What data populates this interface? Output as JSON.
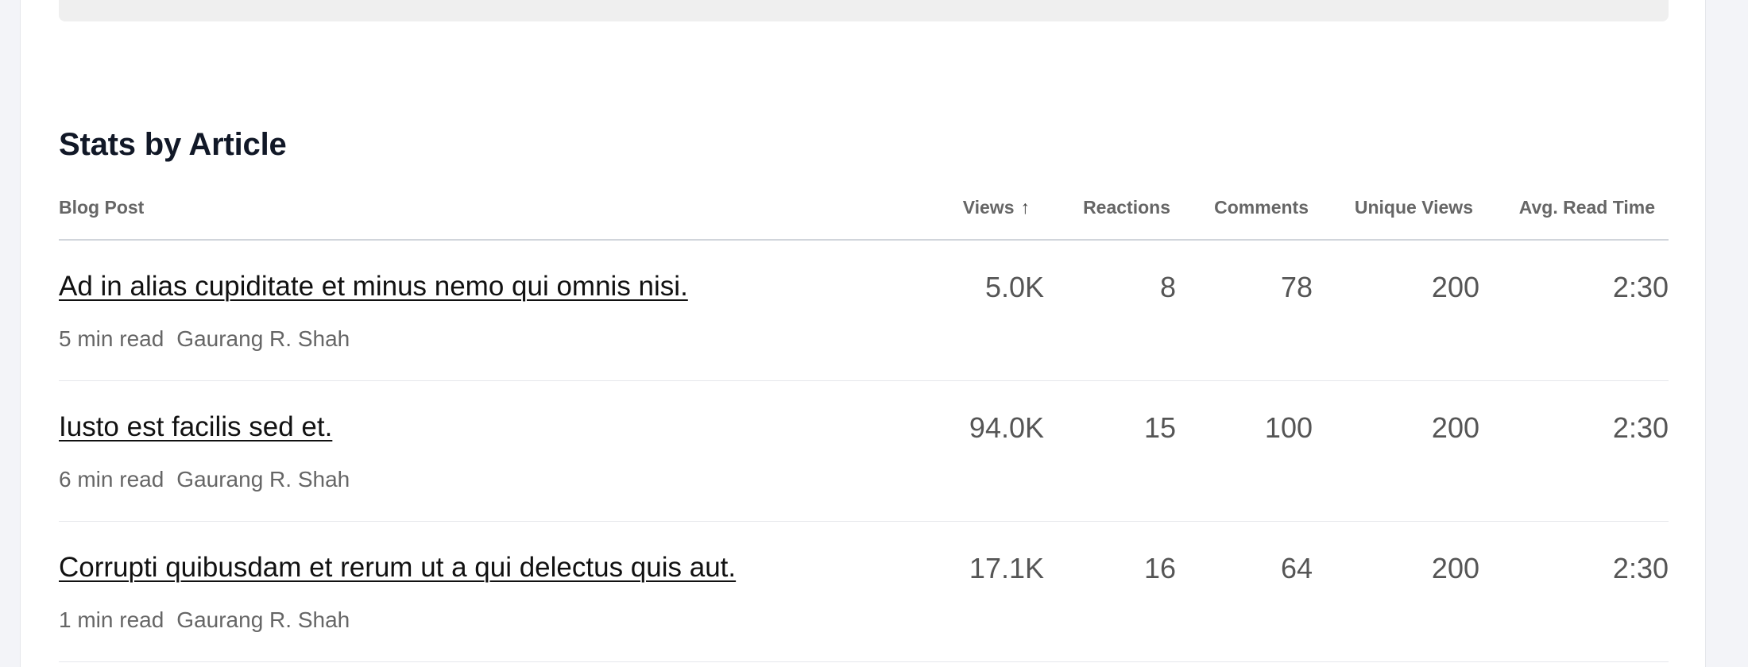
{
  "section": {
    "title": "Stats by Article"
  },
  "table": {
    "headers": {
      "post": "Blog Post",
      "views": "Views",
      "views_sort_icon": "arrow-up-icon",
      "reactions": "Reactions",
      "comments": "Comments",
      "unique_views": "Unique Views",
      "avg_read_time": "Avg. Read Time"
    },
    "rows": [
      {
        "title": "Ad in alias cupiditate et minus nemo qui omnis nisi.",
        "read_time": "5 min read",
        "author": "Gaurang R. Shah",
        "views": "5.0K",
        "reactions": "8",
        "comments": "78",
        "unique_views": "200",
        "avg_read_time": "2:30"
      },
      {
        "title": "Iusto est facilis sed et.",
        "read_time": "6 min read",
        "author": "Gaurang R. Shah",
        "views": "94.0K",
        "reactions": "15",
        "comments": "100",
        "unique_views": "200",
        "avg_read_time": "2:30"
      },
      {
        "title": "Corrupti quibusdam et rerum ut a qui delectus quis aut.",
        "read_time": "1 min read",
        "author": "Gaurang R. Shah",
        "views": "17.1K",
        "reactions": "16",
        "comments": "64",
        "unique_views": "200",
        "avg_read_time": "2:30"
      }
    ]
  }
}
